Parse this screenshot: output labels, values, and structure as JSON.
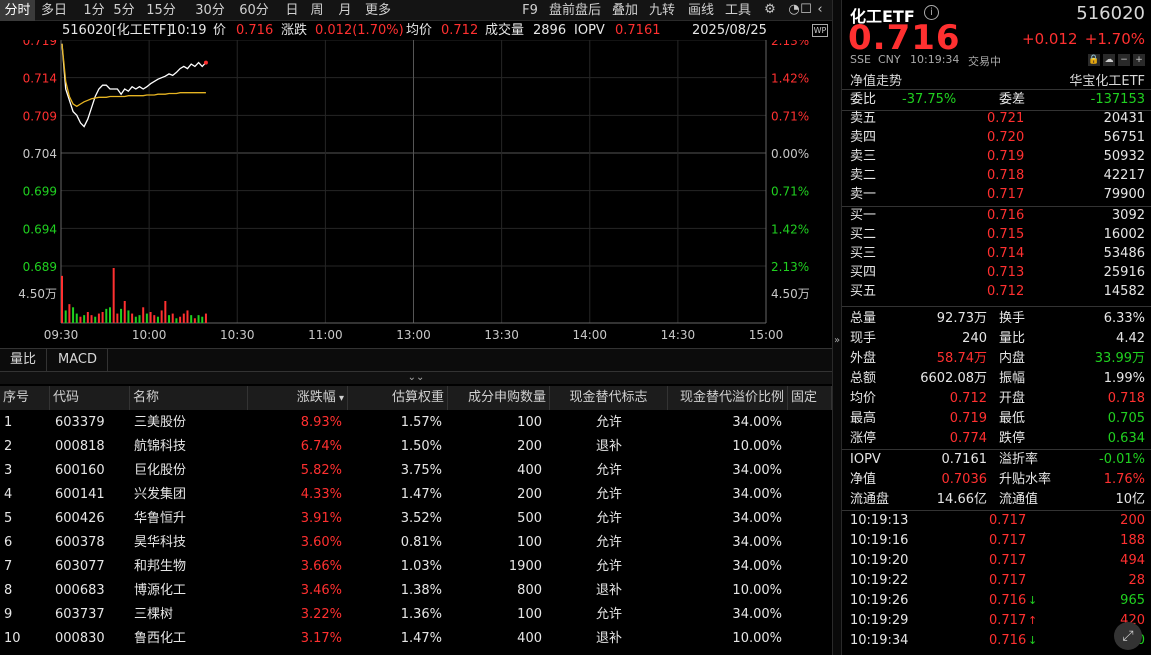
{
  "toolbar": {
    "tabs": [
      "分时",
      "多日",
      "1分",
      "5分",
      "15分",
      "30分",
      "60分",
      "日",
      "周",
      "月",
      "更多"
    ],
    "right_items": [
      "F9",
      "盘前盘后",
      "叠加",
      "九转",
      "画线",
      "工具"
    ],
    "icons": [
      "gear-icon",
      "bell-icon",
      "square-icon",
      "chevron-left-icon"
    ]
  },
  "info": {
    "code_name": "516020[化工ETF]",
    "time": "10:19",
    "price_label": "价",
    "price": "0.716",
    "change_label": "涨跌",
    "change": "0.012(1.70%)",
    "avg_label": "均价",
    "avg": "0.712",
    "volume_label": "成交量",
    "volume": "2896",
    "iopv_label": "IOPV",
    "iopv": "0.7161",
    "date": "2025/08/25"
  },
  "chart_data": {
    "type": "line",
    "x_ticks": [
      "09:30",
      "10:00",
      "10:30",
      "11:00",
      "13:00",
      "13:30",
      "14:00",
      "14:30",
      "15:00"
    ],
    "y_left_ticks": [
      "0.719",
      "0.714",
      "0.709",
      "0.704",
      "0.699",
      "0.694",
      "0.689"
    ],
    "y_right_ticks": [
      "2.13%",
      "1.42%",
      "0.71%",
      "0.00%",
      "0.71%",
      "1.42%",
      "2.13%"
    ],
    "ylim": [
      0.689,
      0.719
    ],
    "prev_close": 0.704,
    "volume_ticks": [
      "4.50万",
      "4.50万"
    ],
    "series": [
      {
        "values": [
          0.7185,
          0.7125,
          0.711,
          0.7095,
          0.709,
          0.708,
          0.7075,
          0.7085,
          0.71,
          0.7115,
          0.7125,
          0.713,
          0.713,
          0.7125,
          0.7125,
          0.7125,
          0.7118,
          0.7125,
          0.7122,
          0.7128,
          0.7125,
          0.7128,
          0.7125,
          0.7128,
          0.7132,
          0.7135,
          0.7138,
          0.714,
          0.7142,
          0.7145,
          0.7143,
          0.7147,
          0.7152,
          0.7155,
          0.7152,
          0.7158,
          0.7155,
          0.716,
          0.7155,
          0.716
        ]
      },
      {
        "values": [
          0.7185,
          0.7135,
          0.7115,
          0.7105,
          0.7102,
          0.7105,
          0.7108,
          0.711,
          0.7112,
          0.7113,
          0.7114,
          0.7114,
          0.7114,
          0.7115,
          0.7115,
          0.7115,
          0.7115,
          0.7115,
          0.7116,
          0.7116,
          0.7116,
          0.7116,
          0.7116,
          0.7117,
          0.7117,
          0.7117,
          0.7118,
          0.7118,
          0.7118,
          0.7119,
          0.7119,
          0.7119,
          0.712,
          0.712,
          0.712,
          0.712,
          0.712,
          0.712,
          0.712,
          0.712
        ]
      }
    ],
    "volume": [
      30,
      8,
      12,
      10,
      6,
      4,
      5,
      7,
      5,
      4,
      6,
      7,
      9,
      10,
      35,
      6,
      9,
      14,
      8,
      6,
      4,
      5,
      10,
      6,
      7,
      5,
      4,
      8,
      14,
      5,
      6,
      3,
      4,
      6,
      8,
      5,
      3,
      5,
      4,
      6
    ],
    "volume_up": [
      true,
      false,
      true,
      false,
      false,
      true,
      false,
      true,
      true,
      false,
      true,
      true,
      false,
      false,
      true,
      true,
      false,
      true,
      false,
      true,
      false,
      false,
      true,
      false,
      true,
      true,
      false,
      true,
      true,
      false,
      true,
      false,
      true,
      true,
      true,
      false,
      true,
      false,
      false,
      true
    ]
  },
  "lower_tabs": [
    "量比",
    "MACD"
  ],
  "table": {
    "headers": [
      "序号",
      "代码",
      "名称",
      "涨跌幅",
      "估算权重",
      "成分申购数量",
      "现金替代标志",
      "现金替代溢价比例",
      "固定"
    ],
    "sort_icon": "caret-down-icon",
    "rows": [
      [
        "1",
        "603379",
        "三美股份",
        "8.93%",
        "1.57%",
        "100",
        "允许",
        "34.00%"
      ],
      [
        "2",
        "000818",
        "航锦科技",
        "6.74%",
        "1.50%",
        "200",
        "退补",
        "10.00%"
      ],
      [
        "3",
        "600160",
        "巨化股份",
        "5.82%",
        "3.75%",
        "400",
        "允许",
        "34.00%"
      ],
      [
        "4",
        "600141",
        "兴发集团",
        "4.33%",
        "1.47%",
        "200",
        "允许",
        "34.00%"
      ],
      [
        "5",
        "600426",
        "华鲁恒升",
        "3.91%",
        "3.52%",
        "500",
        "允许",
        "34.00%"
      ],
      [
        "6",
        "600378",
        "昊华科技",
        "3.60%",
        "0.81%",
        "100",
        "允许",
        "34.00%"
      ],
      [
        "7",
        "603077",
        "和邦生物",
        "3.66%",
        "1.03%",
        "1900",
        "允许",
        "34.00%"
      ],
      [
        "8",
        "000683",
        "博源化工",
        "3.46%",
        "1.38%",
        "800",
        "退补",
        "10.00%"
      ],
      [
        "9",
        "603737",
        "三棵树",
        "3.22%",
        "1.36%",
        "100",
        "允许",
        "34.00%"
      ],
      [
        "10",
        "000830",
        "鲁西化工",
        "3.17%",
        "1.47%",
        "400",
        "退补",
        "10.00%"
      ]
    ]
  },
  "panel": {
    "name": "化工ETF",
    "code": "516020",
    "price": "0.716",
    "change": "+0.012",
    "change_pct": "+1.70%",
    "exchange": "SSE",
    "currency": "CNY",
    "time": "10:19:34",
    "status": "交易中",
    "nav_trend": "净值走势",
    "fund_name": "华宝化工ETF",
    "weibi_label": "委比",
    "weibi": "-37.75%",
    "weicha_label": "委差",
    "weicha": "-137153",
    "asks": [
      {
        "label": "卖五",
        "price": "0.721",
        "vol": "20431"
      },
      {
        "label": "卖四",
        "price": "0.720",
        "vol": "56751"
      },
      {
        "label": "卖三",
        "price": "0.719",
        "vol": "50932"
      },
      {
        "label": "卖二",
        "price": "0.718",
        "vol": "42217"
      },
      {
        "label": "卖一",
        "price": "0.717",
        "vol": "79900"
      }
    ],
    "bids": [
      {
        "label": "买一",
        "price": "0.716",
        "vol": "3092"
      },
      {
        "label": "买二",
        "price": "0.715",
        "vol": "16002"
      },
      {
        "label": "买三",
        "price": "0.714",
        "vol": "53486"
      },
      {
        "label": "买四",
        "price": "0.713",
        "vol": "25916"
      },
      {
        "label": "买五",
        "price": "0.712",
        "vol": "14582"
      }
    ],
    "stats": [
      {
        "l1": "总量",
        "v1": "92.73万",
        "l2": "换手",
        "v2": "6.33%",
        "c1": "white",
        "c2": "white"
      },
      {
        "l1": "现手",
        "v1": "240",
        "l2": "量比",
        "v2": "4.42",
        "c1": "white",
        "c2": "white"
      },
      {
        "l1": "外盘",
        "v1": "58.74万",
        "l2": "内盘",
        "v2": "33.99万",
        "c1": "red",
        "c2": "green"
      },
      {
        "l1": "总额",
        "v1": "6602.08万",
        "l2": "振幅",
        "v2": "1.99%",
        "c1": "white",
        "c2": "white"
      },
      {
        "l1": "均价",
        "v1": "0.712",
        "l2": "开盘",
        "v2": "0.718",
        "c1": "red",
        "c2": "red"
      },
      {
        "l1": "最高",
        "v1": "0.719",
        "l2": "最低",
        "v2": "0.705",
        "c1": "red",
        "c2": "green"
      },
      {
        "l1": "涨停",
        "v1": "0.774",
        "l2": "跌停",
        "v2": "0.634",
        "c1": "red",
        "c2": "green"
      }
    ],
    "stats2": [
      {
        "l1": "IOPV",
        "v1": "0.7161",
        "l2": "溢折率",
        "v2": "-0.01%",
        "c1": "white",
        "c2": "green"
      },
      {
        "l1": "净值",
        "v1": "0.7036",
        "l2": "升贴水率",
        "v2": "1.76%",
        "c1": "red",
        "c2": "red"
      },
      {
        "l1": "流通盘",
        "v1": "14.66亿",
        "l2": "流通值",
        "v2": "10亿",
        "c1": "white",
        "c2": "white"
      }
    ],
    "ticks": [
      {
        "time": "10:19:13",
        "price": "0.717",
        "arrow": "",
        "vol": "200",
        "vc": "red"
      },
      {
        "time": "10:19:16",
        "price": "0.717",
        "arrow": "",
        "vol": "188",
        "vc": "red"
      },
      {
        "time": "10:19:20",
        "price": "0.717",
        "arrow": "",
        "vol": "494",
        "vc": "red"
      },
      {
        "time": "10:19:22",
        "price": "0.717",
        "arrow": "",
        "vol": "28",
        "vc": "red"
      },
      {
        "time": "10:19:26",
        "price": "0.716",
        "arrow": "down",
        "vol": "965",
        "vc": "green"
      },
      {
        "time": "10:19:29",
        "price": "0.717",
        "arrow": "up",
        "vol": "420",
        "vc": "red"
      },
      {
        "time": "10:19:34",
        "price": "0.716",
        "arrow": "down",
        "vol": "240",
        "vc": "green"
      }
    ]
  },
  "colors": {
    "up": "#ff3030",
    "down": "#20d020",
    "avg": "#e6b422",
    "price_line": "#ffffff"
  }
}
